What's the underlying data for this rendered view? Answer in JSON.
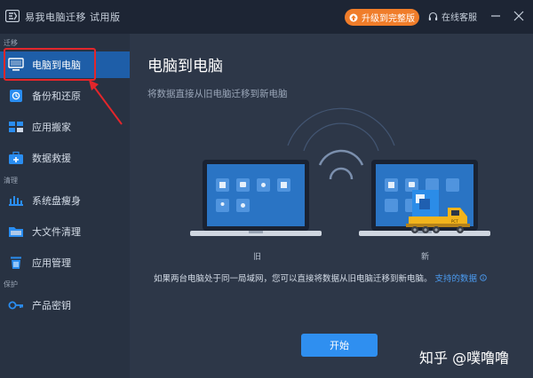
{
  "titlebar": {
    "app_title": "易我电脑迁移 试用版",
    "upgrade_label": "升级到完整版",
    "support_label": "在线客服"
  },
  "sidebar": {
    "sections": [
      {
        "label": "迁移"
      },
      {
        "label": "清理"
      },
      {
        "label": "保护"
      }
    ],
    "items": [
      {
        "label": "电脑到电脑",
        "icon": "monitor-icon"
      },
      {
        "label": "备份和还原",
        "icon": "backup-icon"
      },
      {
        "label": "应用搬家",
        "icon": "app-move-icon"
      },
      {
        "label": "数据救援",
        "icon": "rescue-icon"
      },
      {
        "label": "系统盘瘦身",
        "icon": "disk-slim-icon"
      },
      {
        "label": "大文件清理",
        "icon": "folder-icon"
      },
      {
        "label": "应用管理",
        "icon": "trash-icon"
      },
      {
        "label": "产品密钥",
        "icon": "key-icon"
      }
    ]
  },
  "main": {
    "title": "电脑到电脑",
    "subtitle": "将数据直接从旧电脑迁移到新电脑",
    "old_label": "旧",
    "new_label": "新",
    "description": "如果两台电脑处于同一局域网，您可以直接将数据从旧电脑迁移到新电脑。",
    "supported_data_link": "支持的数据",
    "start_button": "开始"
  },
  "watermark": "知乎 @噗噜噜",
  "colors": {
    "accent_blue": "#1e5ea8",
    "button_blue": "#2f8ff0",
    "upgrade_orange": "#f07d2a",
    "callout_red": "#e3262b"
  }
}
